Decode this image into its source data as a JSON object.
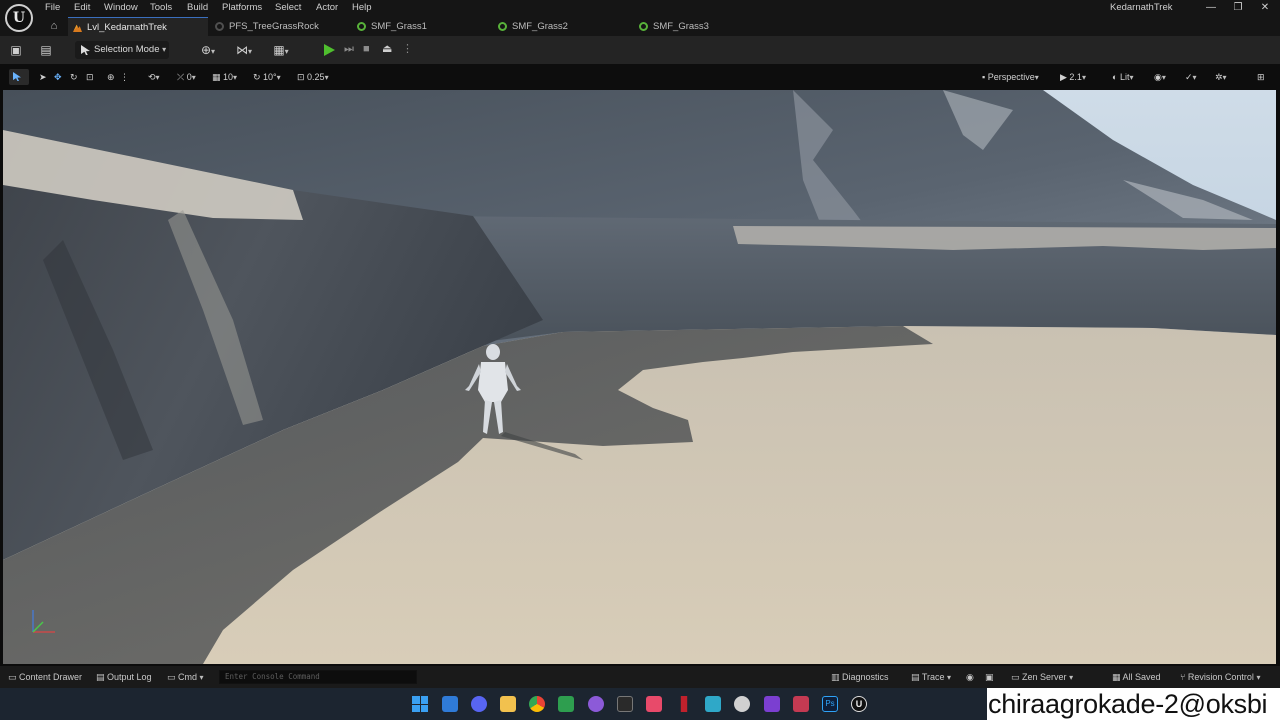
{
  "app": {
    "title": "KedarnathTrek",
    "menu": [
      "File",
      "Edit",
      "Window",
      "Tools",
      "Build",
      "Platforms",
      "Select",
      "Actor",
      "Help"
    ],
    "window_controls": [
      "—",
      "❐",
      "✕"
    ]
  },
  "tabs": [
    {
      "label": "Lvl_KedarnathTrek",
      "icon": "level-icon",
      "active": true
    },
    {
      "label": "PFS_TreeGrassRock",
      "icon": "foliage-icon",
      "active": false
    },
    {
      "label": "SMF_Grass1",
      "icon": "mesh-icon",
      "active": false
    },
    {
      "label": "SMF_Grass2",
      "icon": "mesh-icon",
      "active": false
    },
    {
      "label": "SMF_Grass3",
      "icon": "mesh-icon",
      "active": false
    }
  ],
  "toolbar": {
    "mode_label": "Selection Mode",
    "play_color": "#4fbf2e"
  },
  "viewport_toolbar": {
    "rotation_snap": "0",
    "grid_snap": "10",
    "angle_snap": "10°",
    "scale_snap": "0.25",
    "view_mode": "Perspective",
    "camera_speed": "2.1",
    "lighting_mode": "Lit"
  },
  "statusbar": {
    "content_drawer": "Content Drawer",
    "output_log": "Output Log",
    "cmd": "Cmd",
    "console_placeholder": "Enter Console Command",
    "diagnostics": "Diagnostics",
    "trace": "Trace",
    "zen_server": "Zen Server",
    "all_saved": "All Saved",
    "revision_control": "Revision Control"
  },
  "watermark": {
    "text": "chiraagrokade-2@oksbi"
  },
  "colors": {
    "accent": "#3a6fbf",
    "mesh_tab_icon": "#58b23a",
    "level_tab_icon": "#d87a1e"
  }
}
